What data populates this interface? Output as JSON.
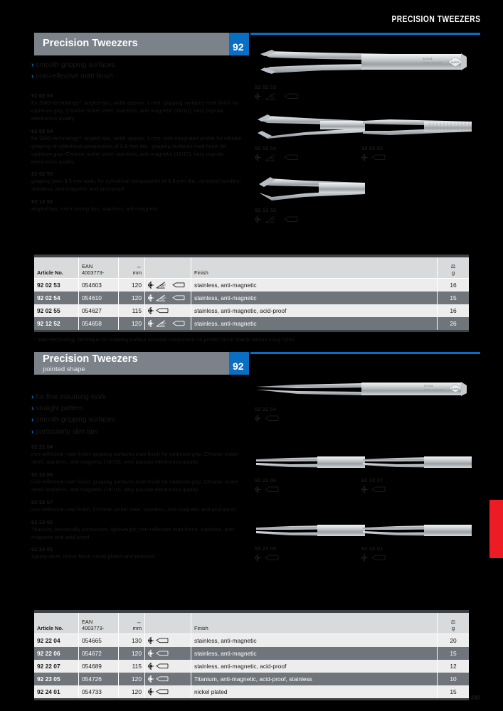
{
  "header": {
    "running_title": "PRECISION TWEEZERS"
  },
  "page": {
    "number": "349",
    "tab_color": "#ed1c24",
    "accent_color": "#0a6fc2",
    "title_bar_color": "#7b828a"
  },
  "sections": [
    {
      "title": "Precision Tweezers",
      "subtitle": "",
      "chapter": "92",
      "bullets": [
        "smooth gripping surfaces",
        "non-reflective matt finish"
      ],
      "descriptions": [
        {
          "number": "92 02 53",
          "text": "for SMD-technology*; angled tips, width approx. 1 mm; gripping surfaces matt finish for optimum grip; Chrome nickel steel: stainless, anti-magnetic (18/10), very popular electronics quality"
        },
        {
          "number": "92 02 54",
          "text": "for SMD-technology*; angled tips, width approx. 1 mm; with integrated profile for reliable gripping of cylindrical components of 0.6 mm dia.; gripping surfaces matt finish for optimum grip; Chrome nickel steel: stainless, anti-magnetic (18/10), very popular electronics quality"
        },
        {
          "number": "92 02 55",
          "text": "gripping jaws 3.5 mm wide, for cylindrical components of 0.8 mm dia.; serrated handles; stainless,  anti-magnetic and acid-proof"
        },
        {
          "number": "92 12 52",
          "text": "angled tips; extra strong tips;  stainless, anti-magnetic"
        }
      ],
      "photos": [
        {
          "label": "92 02 53",
          "angle": "45°",
          "has_angle": true,
          "stamp_line1": "92 02 53",
          "stamp_line2": "stainless · anti-magnetic"
        },
        {
          "label": "92 02 54",
          "angle": "45°",
          "has_angle": true,
          "stamp_line1": "",
          "stamp_line2": ""
        },
        {
          "label": "92 02 55",
          "angle": "",
          "has_angle": false,
          "stamp_line1": "",
          "stamp_line2": ""
        },
        {
          "label": "92 12 52",
          "angle": "25°",
          "has_angle": true,
          "stamp_line1": "",
          "stamp_line2": ""
        }
      ],
      "table": {
        "headers": {
          "article": "Article No.",
          "ean_l1": "EAN",
          "ean_l2": "4003773-",
          "len_l1": "↔",
          "len_l2": "mm",
          "icons": "",
          "finish": "Finish",
          "weight_l1": "⚖",
          "weight_l2": "g"
        },
        "rows": [
          {
            "article": "92 02 53",
            "ean": "054603",
            "length": "120",
            "angle": "45°",
            "has_angle": true,
            "finish": "stainless, anti-magnetic",
            "weight": "16"
          },
          {
            "article": "92 02 54",
            "ean": "054610",
            "length": "120",
            "angle": "45°",
            "has_angle": true,
            "finish": "stainless, anti-magnetic",
            "weight": "15"
          },
          {
            "article": "92 02 55",
            "ean": "054627",
            "length": "115",
            "angle": "",
            "has_angle": false,
            "finish": "stainless, anti-magnetic, acid-proof",
            "weight": "16"
          },
          {
            "article": "92 12 52",
            "ean": "054658",
            "length": "120",
            "angle": "25°",
            "has_angle": true,
            "finish": "stainless, anti-magnetic",
            "weight": "26"
          }
        ],
        "footnote": "* SMD-Technology: technique for soldering surface mounted components on printed circuit boards without using holes"
      }
    },
    {
      "title": "Precision Tweezers",
      "subtitle": "pointed shape",
      "chapter": "92",
      "bullets": [
        "for fine mounting work",
        "straight pattern",
        "smooth gripping surfaces",
        "particularly slim tips"
      ],
      "descriptions": [
        {
          "number": "92 22 04",
          "text": "non-reflective matt finish; gripping surfaces matt finish for optimum grip; Chrome nickel steel: stainless, anti-magnetic (18/10), very popular electronics quality"
        },
        {
          "number": "92 22 06",
          "text": "non-reflective matt finish; gripping surfaces matt finish for optimum grip; Chrome nickel steel: stainless, anti-magnetic (18/10), very popular electronics quality"
        },
        {
          "number": "92 22 07",
          "text": "non-reflective matt finish; Chrome nickel steel: stainless, anti-magnetic and acid-proof"
        },
        {
          "number": "92 23 05",
          "text": "Titanium; electrically conductive; lightweight; non-reflective matt finish; stainless, anti-magnetic and acid-proof"
        },
        {
          "number": "92 24 01",
          "text": "Spring steel; mirror finish nickel plated and polished"
        }
      ],
      "photos": [
        {
          "label": "92 22 04",
          "angle": "",
          "has_angle": false,
          "stamp_line1": "92 22 04",
          "stamp_line2": "stainless · anti-magnetic"
        },
        {
          "label": "92 22 06",
          "angle": "",
          "has_angle": false,
          "stamp_line1": "",
          "stamp_line2": ""
        },
        {
          "label": "92 22 07",
          "angle": "",
          "has_angle": false,
          "stamp_line1": "",
          "stamp_line2": ""
        },
        {
          "label": "92 23 05",
          "angle": "",
          "has_angle": false,
          "stamp_line1": "",
          "stamp_line2": ""
        },
        {
          "label": "92 24 01",
          "angle": "",
          "has_angle": false,
          "stamp_line1": "",
          "stamp_line2": ""
        }
      ],
      "table": {
        "headers": {
          "article": "Article No.",
          "ean_l1": "EAN",
          "ean_l2": "4003773-",
          "len_l1": "↔",
          "len_l2": "mm",
          "icons": "",
          "finish": "Finish",
          "weight_l1": "⚖",
          "weight_l2": "g"
        },
        "rows": [
          {
            "article": "92 22 04",
            "ean": "054665",
            "length": "130",
            "angle": "",
            "has_angle": false,
            "finish": "stainless, anti-magnetic",
            "weight": "20"
          },
          {
            "article": "92 22 06",
            "ean": "054672",
            "length": "120",
            "angle": "",
            "has_angle": false,
            "finish": "stainless, anti-magnetic",
            "weight": "15"
          },
          {
            "article": "92 22 07",
            "ean": "054689",
            "length": "115",
            "angle": "",
            "has_angle": false,
            "finish": "stainless, anti-magnetic, acid-proof",
            "weight": "12"
          },
          {
            "article": "92 23 05",
            "ean": "054726",
            "length": "120",
            "angle": "",
            "has_angle": false,
            "finish": "Titanium, anti-magnetic, acid-proof, stainless",
            "weight": "10"
          },
          {
            "article": "92 24 01",
            "ean": "054733",
            "length": "120",
            "angle": "",
            "has_angle": false,
            "finish": "nickel plated",
            "weight": "15"
          }
        ],
        "footnote": ""
      }
    }
  ]
}
